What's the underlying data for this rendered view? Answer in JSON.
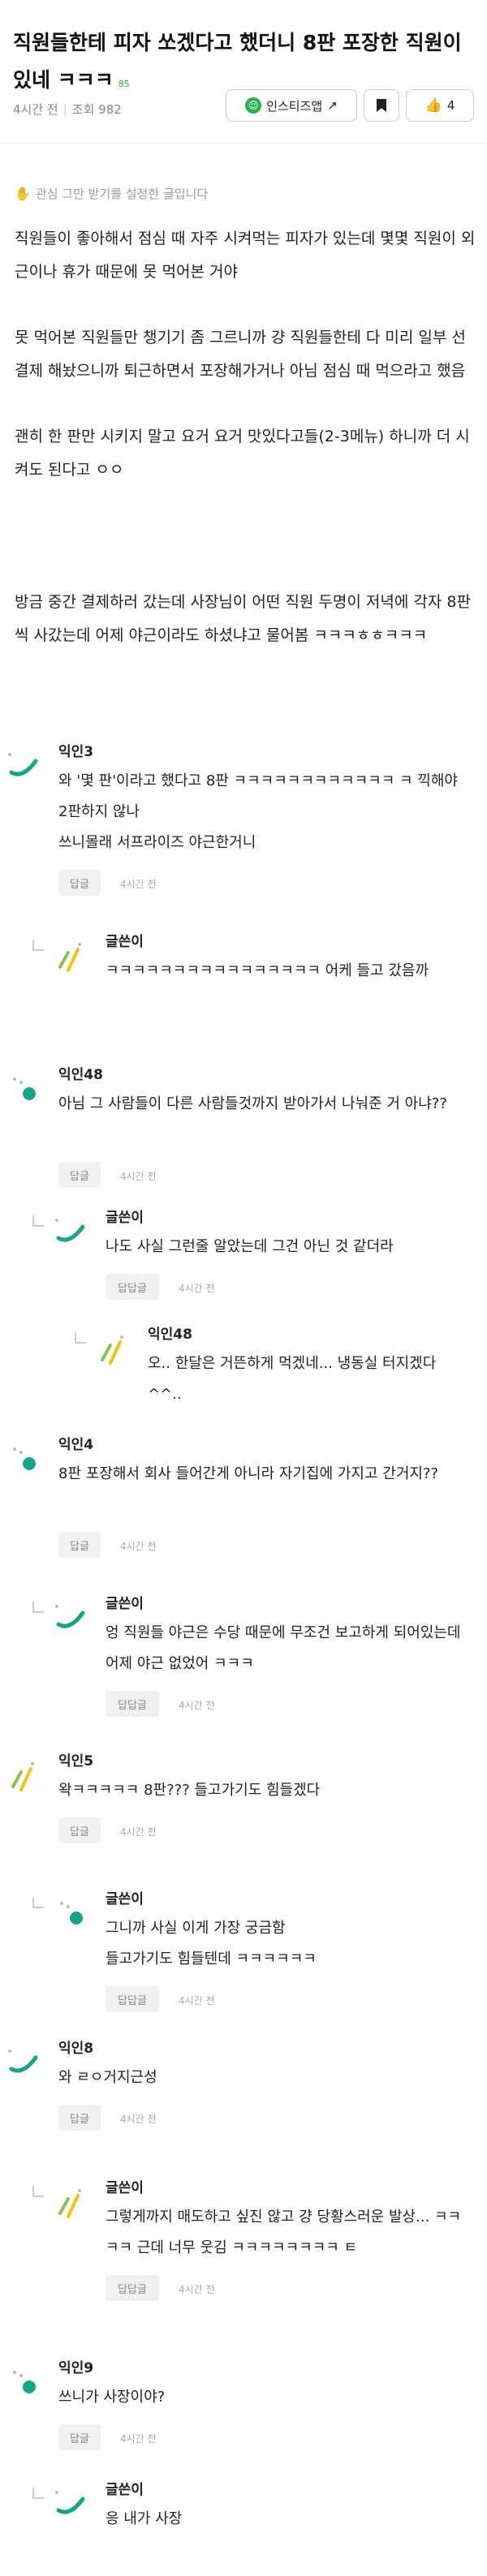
{
  "post": {
    "title": "직원들한테 피자 쏘겠다고 했더니 8판 포장한 직원이 있네 ㅋㅋㅋ",
    "comment_count": "85",
    "time": "4시간 전",
    "views": "조회 982",
    "notice": "관심 그만 받기를 설정한 글입니다",
    "body": [
      "직원들이 좋아해서 점심 때 자주 시켜먹는 피자가 있는데 몇몇 직원이 외근이나 휴가 때문에 못 먹어본 거야",
      "못 먹어본 직원들만 챙기기 좀 그르니까 걍 직원들한테 다 미리 일부 선결제 해놨으니까 퇴근하면서 포장해가거나 아님 점심 때 먹으라고 했음",
      "괜히 한 판만 시키지 말고 요거 요거 맛있다고들(2-3메뉴) 하니까 더 시켜도 된다고 ㅇㅇ",
      "방금 중간 결제하러 갔는데 사장님이 어떤 직원 두명이 저녁에 각자 8판씩 사갔는데 어제 야근이라도 하셨냐고 물어봄 ㅋㅋㅋㅎㅎㅋㅋㅋ"
    ]
  },
  "toolbar": {
    "app_label": "인스티즈앱",
    "likes": "4"
  },
  "labels": {
    "reply": "답글",
    "reply_reply": "답답글",
    "time": "4시간 전"
  },
  "comments": [
    {
      "depth": 0,
      "nick": "익인3",
      "lines": [
        "와 '몇 판'이라고 했다고 8판 ㅋㅋㅋㅋㅋㅋㅋㅋㅋㅋㅋㅋ ㅋ 끽해야 2판하지 않나",
        "쓰니몰래 서프라이즈 야근한거니"
      ],
      "btn": "reply"
    },
    {
      "depth": 1,
      "nick": "글쓴이",
      "lines": [
        "ㅋㅋㅋㅋㅋㅋㅋㅋㅋㅋㅋㅋㅋㅋㅋㅋ 어케 들고 갔음까"
      ],
      "btn": null
    },
    {
      "depth": 0,
      "nick": "익인48",
      "lines": [
        "아님 그 사람들이 다른 사람들것까지 받아가서 나눠준 거 아냐??"
      ],
      "btn": "reply"
    },
    {
      "depth": 1,
      "nick": "글쓴이",
      "lines": [
        "나도 사실 그런줄 알았는데 그건 아닌 것 같더라"
      ],
      "btn": "reply_reply"
    },
    {
      "depth": 2,
      "nick": "익인48",
      "lines": [
        "오.. 한달은 거뜬하게 먹겠네... 냉동실 터지겠다 ^^.."
      ],
      "btn": null
    },
    {
      "depth": 0,
      "nick": "익인4",
      "lines": [
        "8판 포장해서 회사 들어간게 아니라 자기집에 가지고 간거지??"
      ],
      "btn": "reply"
    },
    {
      "depth": 1,
      "nick": "글쓴이",
      "lines": [
        "엉 직원들 야근은 수당 때문에 무조건 보고하게 되어있는데 어제 야근 없었어 ㅋㅋㅋ"
      ],
      "btn": "reply_reply"
    },
    {
      "depth": 0,
      "nick": "익인5",
      "lines": [
        "왁ㅋㅋㅋㅋㅋ 8판??? 들고가기도 힘들겠다"
      ],
      "btn": "reply"
    },
    {
      "depth": 1,
      "nick": "글쓴이",
      "lines": [
        "그니까 사실 이게 가장 궁금함",
        "들고가기도 힘들텐데 ㅋㅋㅋㅋㅋㅋ"
      ],
      "btn": "reply_reply"
    },
    {
      "depth": 0,
      "nick": "익인8",
      "lines": [
        "와 ㄹㅇ거지근성"
      ],
      "btn": "reply"
    },
    {
      "depth": 1,
      "nick": "글쓴이",
      "lines": [
        "그렇게까지 매도하고 싶진 않고 걍 당황스러운 발상... ㅋㅋㅋㅋ 근데 너무 웃김 ㅋㅋㅋㅋㅋㅋㅋㅋ ㅌ"
      ],
      "btn": "reply_reply"
    },
    {
      "depth": 0,
      "nick": "익인9",
      "lines": [
        "쓰니가 사장이야?"
      ],
      "btn": "reply"
    },
    {
      "depth": 1,
      "nick": "글쓴이",
      "lines": [
        "응 내가 사장"
      ],
      "btn": null
    }
  ],
  "colors": {
    "brand_green": "#2bb24c",
    "avatar_teal": "#17a589",
    "avatar_lime": "#8bc34a",
    "avatar_yellow": "#f1c40f"
  }
}
